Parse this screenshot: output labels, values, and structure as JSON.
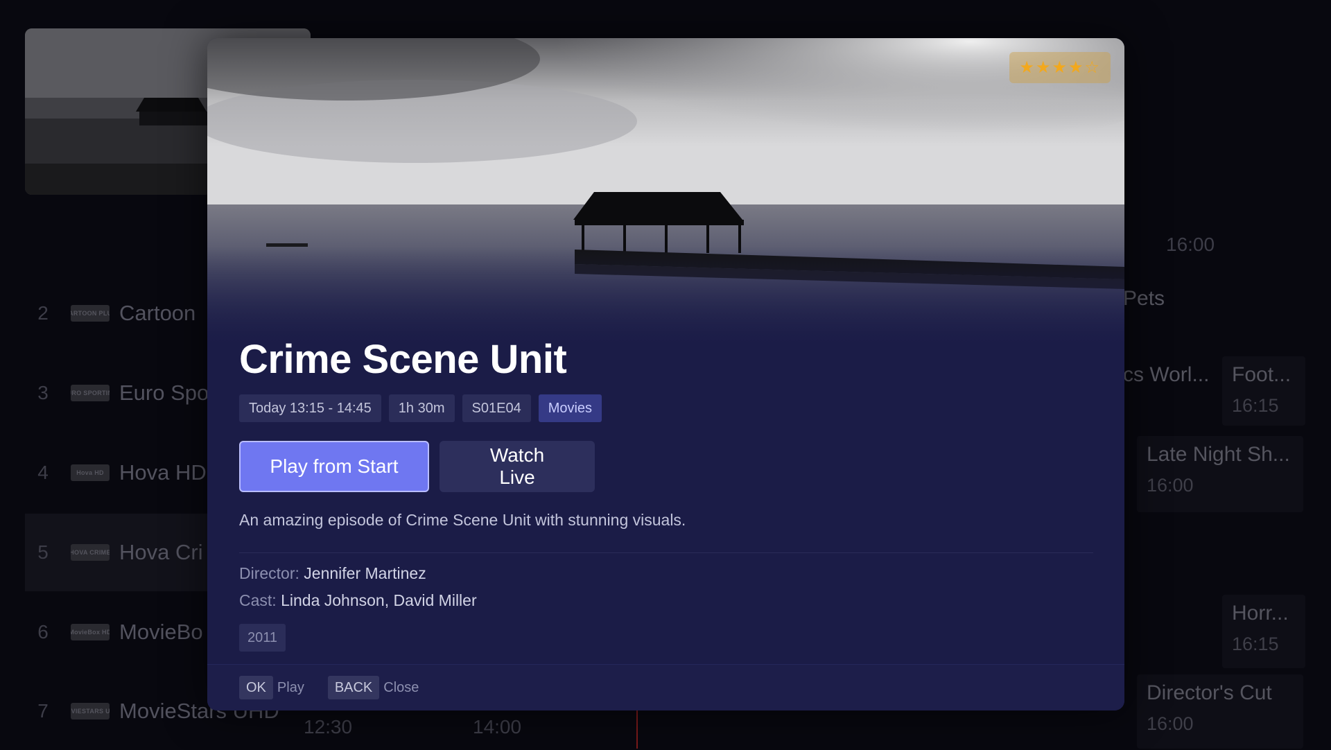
{
  "epg": {
    "channels": [
      {
        "number": "2",
        "logo": "CARTOON PLUS",
        "name": "Cartoon"
      },
      {
        "number": "3",
        "logo": "EURO SPORTING",
        "name": "Euro Spo"
      },
      {
        "number": "4",
        "logo": "Hova HD",
        "name": "Hova HD"
      },
      {
        "number": "5",
        "logo": "HOVA CRIME",
        "name": "Hova Cri"
      },
      {
        "number": "6",
        "logo": "MovieBox HD",
        "name": "MovieBo"
      },
      {
        "number": "7",
        "logo": "MOVIESTARS UHD",
        "name": "MovieStars UHD"
      }
    ],
    "times": [
      "16:00",
      "12:30",
      "14:00"
    ],
    "programs": [
      {
        "title": "Pets",
        "time": ""
      },
      {
        "title": "cs Worl...",
        "time": ""
      },
      {
        "title": "Foot...",
        "time": "16:15"
      },
      {
        "title": "Late Night Sh...",
        "time": "16:00"
      },
      {
        "title": "Horr...",
        "time": "16:15"
      },
      {
        "title": "Director's Cut",
        "time": "16:00"
      }
    ]
  },
  "modal": {
    "rating_stars": "★★★★☆",
    "rating_value": 4,
    "title": "Crime Scene Unit",
    "meta": {
      "time": "Today 13:15 - 14:45",
      "duration": "1h 30m",
      "episode": "S01E04",
      "genre": "Movies"
    },
    "play_label": "Play from Start",
    "live_label": "Watch Live",
    "description": "An amazing episode of Crime Scene Unit with stunning visuals.",
    "director_label": "Director:",
    "director": "Jennifer Martinez",
    "cast_label": "Cast:",
    "cast": "Linda Johnson, David Miller",
    "year": "2011",
    "footer": {
      "ok_key": "OK",
      "ok_label": "Play",
      "back_key": "BACK",
      "back_label": "Close"
    }
  },
  "colors": {
    "modal_bg": "#1b1c47",
    "primary": "#6f77f1",
    "star": "#f2a81d"
  }
}
